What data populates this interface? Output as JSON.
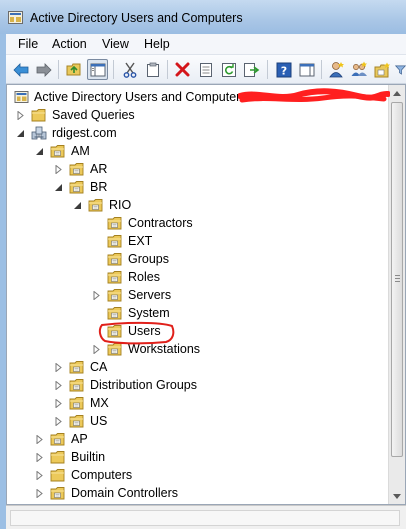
{
  "window": {
    "title": "Active Directory Users and Computers",
    "title_bar_color": "#a9c6e6"
  },
  "menu": {
    "items": [
      "File",
      "Action",
      "View",
      "Help"
    ]
  },
  "toolbar": {
    "buttons": [
      {
        "icon": "back-arrow-icon"
      },
      {
        "icon": "forward-arrow-icon"
      },
      {
        "icon": "up-folder-icon"
      },
      {
        "icon": "show-hide-console-tree-icon",
        "active": true
      },
      {
        "icon": "cut-icon"
      },
      {
        "icon": "copy-icon"
      },
      {
        "icon": "delete-icon"
      },
      {
        "icon": "properties-icon"
      },
      {
        "icon": "refresh-icon"
      },
      {
        "icon": "export-list-icon"
      },
      {
        "icon": "help-icon"
      },
      {
        "icon": "show-hide-action-pane-icon"
      },
      {
        "icon": "create-user-icon"
      },
      {
        "icon": "create-group-icon"
      },
      {
        "icon": "create-ou-icon"
      },
      {
        "icon": "filter-icon"
      }
    ]
  },
  "tree": {
    "root": "Active Directory Users and Computers",
    "root_suffix_redacted": true,
    "redaction_color": "#ff1f1f",
    "highlight_color": "#e0201a",
    "nodes": [
      {
        "label": "Saved Queries",
        "depth": 1,
        "expander": "collapsed",
        "icon": "folder"
      },
      {
        "label": "rdigest.com",
        "depth": 1,
        "expander": "expanded",
        "icon": "domain"
      },
      {
        "label": "AM",
        "depth": 2,
        "expander": "expanded",
        "icon": "ou"
      },
      {
        "label": "AR",
        "depth": 3,
        "expander": "collapsed",
        "icon": "ou"
      },
      {
        "label": "BR",
        "depth": 3,
        "expander": "expanded",
        "icon": "ou"
      },
      {
        "label": "RIO",
        "depth": 4,
        "expander": "expanded",
        "icon": "ou"
      },
      {
        "label": "Contractors",
        "depth": 5,
        "expander": "none",
        "icon": "ou"
      },
      {
        "label": "EXT",
        "depth": 5,
        "expander": "none",
        "icon": "ou"
      },
      {
        "label": "Groups",
        "depth": 5,
        "expander": "none",
        "icon": "ou"
      },
      {
        "label": "Roles",
        "depth": 5,
        "expander": "none",
        "icon": "ou"
      },
      {
        "label": "Servers",
        "depth": 5,
        "expander": "collapsed",
        "icon": "ou"
      },
      {
        "label": "System",
        "depth": 5,
        "expander": "none",
        "icon": "ou"
      },
      {
        "label": "Users",
        "depth": 5,
        "expander": "none",
        "icon": "ou",
        "circled": true
      },
      {
        "label": "Workstations",
        "depth": 5,
        "expander": "collapsed",
        "icon": "ou"
      },
      {
        "label": "CA",
        "depth": 3,
        "expander": "collapsed",
        "icon": "ou"
      },
      {
        "label": "Distribution Groups",
        "depth": 3,
        "expander": "collapsed",
        "icon": "ou"
      },
      {
        "label": "MX",
        "depth": 3,
        "expander": "collapsed",
        "icon": "ou"
      },
      {
        "label": "US",
        "depth": 3,
        "expander": "collapsed",
        "icon": "ou"
      },
      {
        "label": "AP",
        "depth": 2,
        "expander": "collapsed",
        "icon": "ou"
      },
      {
        "label": "Builtin",
        "depth": 2,
        "expander": "collapsed",
        "icon": "folder"
      },
      {
        "label": "Computers",
        "depth": 2,
        "expander": "collapsed",
        "icon": "folder"
      },
      {
        "label": "Domain Controllers",
        "depth": 2,
        "expander": "collapsed",
        "icon": "ou"
      }
    ]
  }
}
